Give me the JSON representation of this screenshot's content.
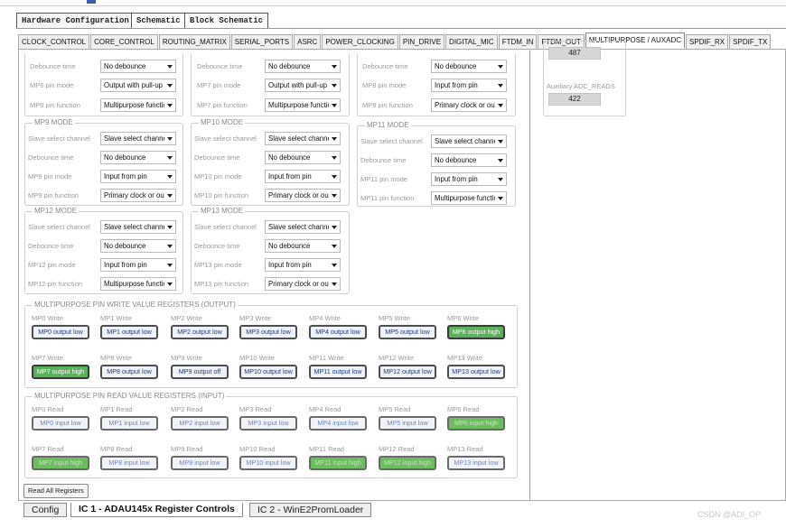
{
  "top_tabs": [
    "Hardware Configuration",
    "Schematic",
    "Block Schematic"
  ],
  "tabs": [
    "CLOCK_CONTROL",
    "CORE_CONTROL",
    "ROUTING_MATRIX",
    "SERIAL_PORTS",
    "ASRC",
    "POWER_CLOCKING",
    "PIN_DRIVE",
    "DIGITAL_MIC",
    "FTDM_IN",
    "FTDM_OUT",
    "MULTIPURPOSE / AUXADC",
    "SPDIF_RX",
    "SPDIF_TX"
  ],
  "top_partial": [
    {
      "rows": [
        {
          "label": "Debounce time",
          "value": "No debounce"
        },
        {
          "label": "MP6 pin mode",
          "value": "Output with pull-up"
        },
        {
          "label": "MP6 pin function",
          "value": "Multipurpose function"
        }
      ]
    },
    {
      "rows": [
        {
          "label": "Debounce time",
          "value": "No debounce"
        },
        {
          "label": "MP7 pin mode",
          "value": "Output with pull-up"
        },
        {
          "label": "MP7 pin function",
          "value": "Multipurpose function"
        }
      ]
    },
    {
      "rows": [
        {
          "label": "Debounce time",
          "value": "No debounce"
        },
        {
          "label": "MP8 pin mode",
          "value": "Input from pin"
        },
        {
          "label": "MP8 pin function",
          "value": "Primary clock or output"
        }
      ]
    }
  ],
  "mp_groups": [
    {
      "title": "MP9 MODE",
      "rows": [
        {
          "label": "Slave select channel",
          "value": "Slave select channel"
        },
        {
          "label": "Debounce time",
          "value": "No debounce"
        },
        {
          "label": "MP9 pin mode",
          "value": "Input from pin"
        },
        {
          "label": "MP9 pin function",
          "value": "Primary clock or output"
        }
      ]
    },
    {
      "title": "MP10 MODE",
      "rows": [
        {
          "label": "Slave select channel",
          "value": "Slave select channel"
        },
        {
          "label": "Debounce time",
          "value": "No debounce"
        },
        {
          "label": "MP10 pin mode",
          "value": "Input from pin"
        },
        {
          "label": "MP10 pin function",
          "value": "Primary clock or output"
        }
      ]
    },
    {
      "title": "MP11 MODE",
      "rows": [
        {
          "label": "Slave select channel",
          "value": "Slave select channel"
        },
        {
          "label": "Debounce time",
          "value": "No debounce"
        },
        {
          "label": "MP11 pin mode",
          "value": "Input from pin"
        },
        {
          "label": "MP11 pin function",
          "value": "Multipurpose function"
        }
      ]
    },
    {
      "title": "MP12 MODE",
      "rows": [
        {
          "label": "Slave select channel",
          "value": "Slave select channel"
        },
        {
          "label": "Debounce time",
          "value": "No debounce"
        },
        {
          "label": "MP12 pin mode",
          "value": "Input from pin"
        },
        {
          "label": "MP12 pin function",
          "value": "Multipurpose function"
        }
      ]
    },
    {
      "title": "MP13 MODE",
      "rows": [
        {
          "label": "Slave select channel",
          "value": "Slave select channel"
        },
        {
          "label": "Debounce time",
          "value": "No debounce"
        },
        {
          "label": "MP13 pin mode",
          "value": "Input from pin"
        },
        {
          "label": "MP13 pin function",
          "value": "Primary clock or output"
        }
      ]
    }
  ],
  "write_section": {
    "title": "MULTIPURPOSE PIN WRITE VALUE REGISTERS (OUTPUT)",
    "items": [
      {
        "label": "MP0 Write",
        "value": "MP0 output low",
        "active": false
      },
      {
        "label": "MP1 Write",
        "value": "MP1 output low",
        "active": false
      },
      {
        "label": "MP2 Write",
        "value": "MP2 output low",
        "active": false
      },
      {
        "label": "MP3 Write",
        "value": "MP3 output low",
        "active": false
      },
      {
        "label": "MP4 Write",
        "value": "MP4 output low",
        "active": false
      },
      {
        "label": "MP5 Write",
        "value": "MP5 output low",
        "active": false
      },
      {
        "label": "MP6 Write",
        "value": "MP6 output high",
        "active": true
      },
      {
        "label": "MP7 Write",
        "value": "MP7 output high",
        "active": true
      },
      {
        "label": "MP8 Write",
        "value": "MP8 output low",
        "active": false
      },
      {
        "label": "MP9 Write",
        "value": "MP9 output off",
        "active": false
      },
      {
        "label": "MP10 Write",
        "value": "MP10 output low",
        "active": false
      },
      {
        "label": "MP11 Write",
        "value": "MP11 output low",
        "active": false
      },
      {
        "label": "MP12 Write",
        "value": "MP12 output low",
        "active": false
      },
      {
        "label": "MP13 Write",
        "value": "MP13 output low",
        "active": false
      }
    ]
  },
  "read_section": {
    "title": "MULTIPURPOSE PIN READ VALUE REGISTERS (INPUT)",
    "items": [
      {
        "label": "MP0 Read",
        "value": "MP0 input low",
        "active": false
      },
      {
        "label": "MP1 Read",
        "value": "MP1 input low",
        "active": false
      },
      {
        "label": "MP2 Read",
        "value": "MP2 input low",
        "active": false
      },
      {
        "label": "MP3 Read",
        "value": "MP3 input low",
        "active": false
      },
      {
        "label": "MP4 Read",
        "value": "MP4 input low",
        "active": false
      },
      {
        "label": "MP5 Read",
        "value": "MP5 input low",
        "active": false
      },
      {
        "label": "MP6 Read",
        "value": "MP6 input high",
        "active": true
      },
      {
        "label": "MP7 Read",
        "value": "MP7 input high",
        "active": true
      },
      {
        "label": "MP8 Read",
        "value": "MP8 input low",
        "active": false
      },
      {
        "label": "MP9 Read",
        "value": "MP9 input low",
        "active": false
      },
      {
        "label": "MP10 Read",
        "value": "MP10 input low",
        "active": false
      },
      {
        "label": "MP11 Read",
        "value": "MP11 input high",
        "active": true
      },
      {
        "label": "MP12 Read",
        "value": "MP12 input high",
        "active": true
      },
      {
        "label": "MP13 Read",
        "value": "MP13 input low",
        "active": false
      }
    ]
  },
  "auxadc": {
    "value1": "487",
    "label2": "Auxiliary ADC_READS",
    "value2": "422"
  },
  "read_all_label": "Read All Registers",
  "bottom_tabs": [
    "Config",
    "IC 1 - ADAU145x Register Controls",
    "IC 2 - WinE2PromLoader"
  ],
  "watermark": "CSDN @ADI_OP",
  "colors": {
    "active_green": "#59b259",
    "button_text": "#1c3d86"
  }
}
